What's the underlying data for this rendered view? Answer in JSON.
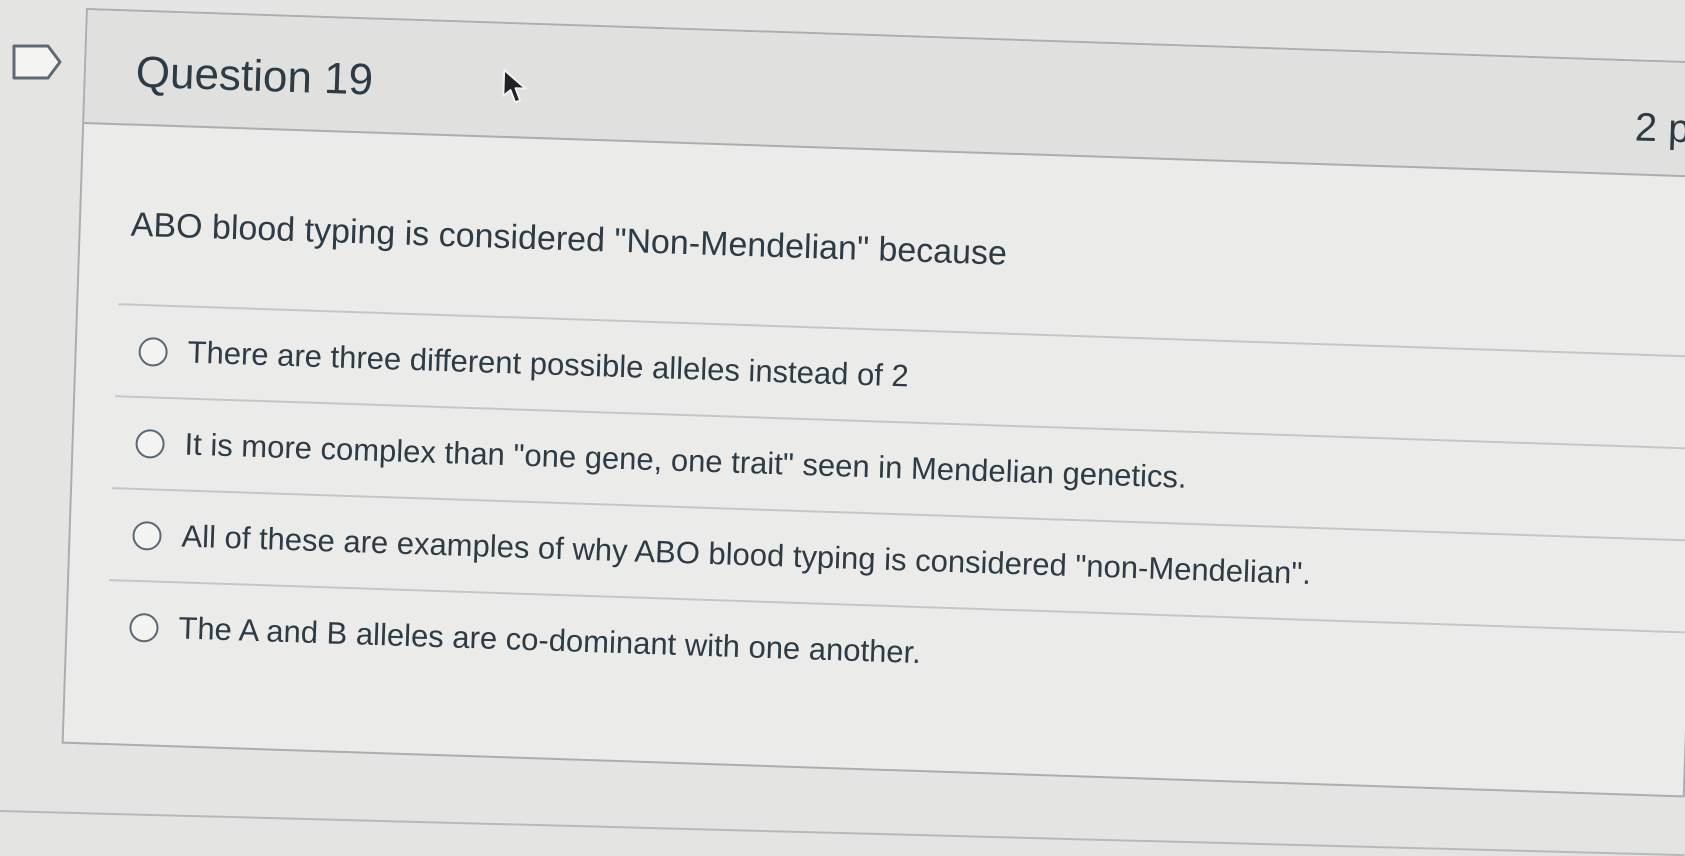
{
  "question": {
    "title": "Question 19",
    "points": "2 p",
    "text": "ABO blood typing is considered \"Non-Mendelian\" because"
  },
  "answers": [
    {
      "label": "There are three different possible alleles instead of 2"
    },
    {
      "label": "It is more complex than \"one gene, one trait\" seen in Mendelian genetics."
    },
    {
      "label": "All of these are examples of why ABO blood typing is considered \"non-Mendelian\"."
    },
    {
      "label": "The A and B alleles are co-dominant with one another."
    }
  ],
  "icons": {
    "flag": "bookmark-flag-icon",
    "cursor": "mouse-pointer-icon"
  },
  "colors": {
    "text": "#2d3b45",
    "border": "#a9aeb1",
    "background": "#e4e4e2"
  }
}
